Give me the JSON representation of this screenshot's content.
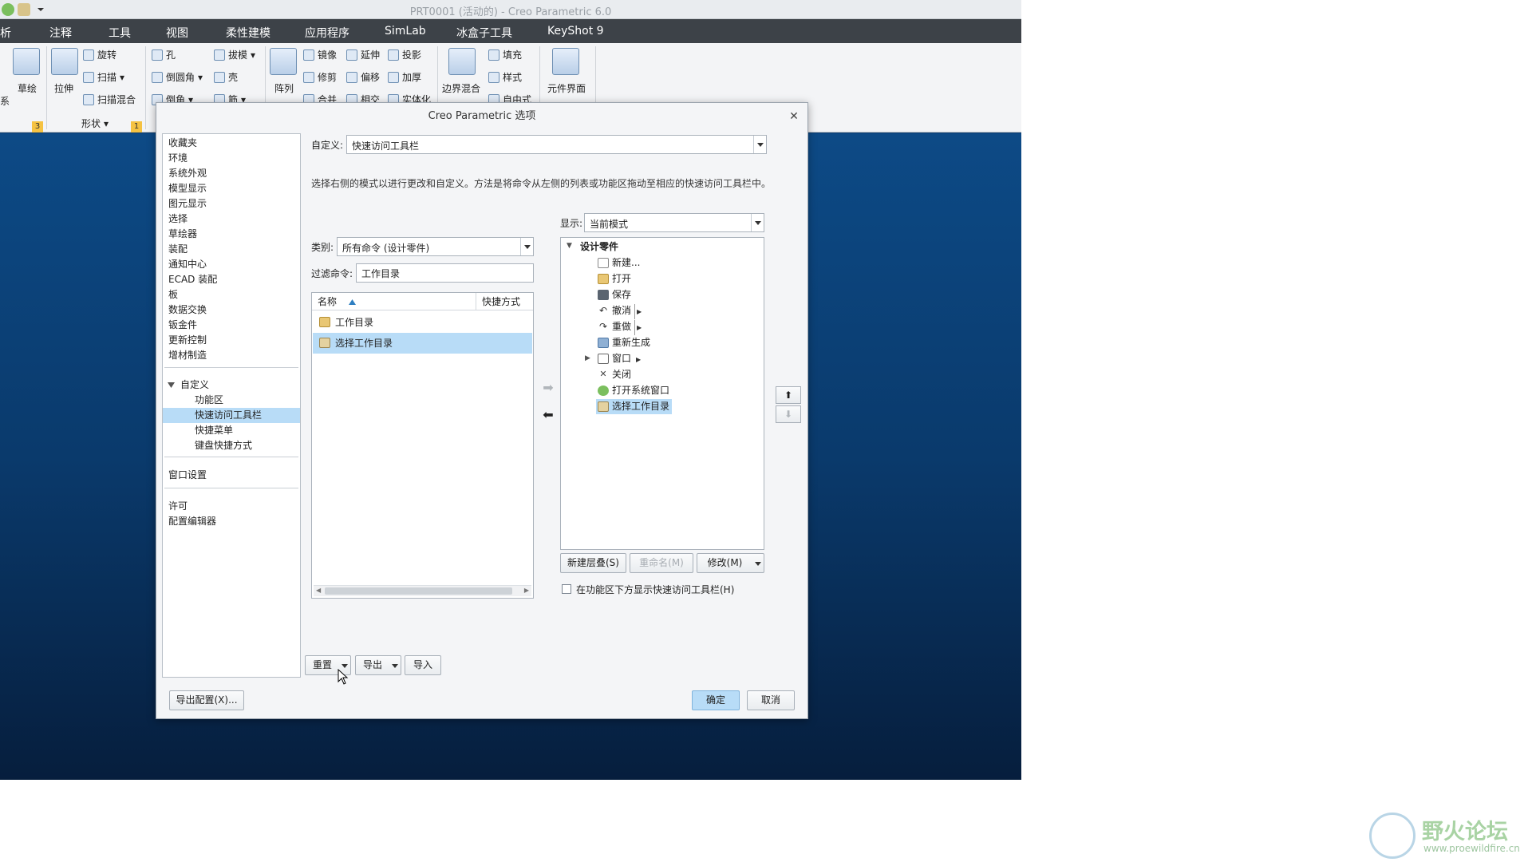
{
  "window": {
    "title": "PRT0001 (活动的) - Creo Parametric 6.0"
  },
  "menu": [
    "析",
    "注释",
    "工具",
    "视图",
    "柔性建模",
    "应用程序",
    "SimLab",
    "冰盒子工具",
    "KeyShot 9"
  ],
  "ribbon": {
    "sketch": "草绘",
    "extrude": "拉伸",
    "revolve": "旋转",
    "sweep": "扫描",
    "swept_blend": "扫描混合",
    "system": "系",
    "hole": "孔",
    "round": "倒圆角",
    "chamfer": "倒角",
    "draft": "拔模",
    "shell": "壳",
    "rib": "筋",
    "shape_group": "形状",
    "pattern": "阵列",
    "mirror": "镜像",
    "trim": "修剪",
    "merge": "合并",
    "extend": "延伸",
    "offset": "偏移",
    "intersect": "相交",
    "project": "投影",
    "thicken": "加厚",
    "solidify": "实体化",
    "boundary_blend": "边界混合",
    "fill": "填充",
    "style": "样式",
    "freestyle": "自由式",
    "component_interface": "元件界面",
    "badge_3": "3",
    "badge_1": "1"
  },
  "dialog": {
    "title": "Creo Parametric 选项",
    "nav_items": [
      "收藏夹",
      "环境",
      "系统外观",
      "模型显示",
      "图元显示",
      "选择",
      "草绘器",
      "装配",
      "通知中心",
      "ECAD 装配",
      "板",
      "数据交换",
      "钣金件",
      "更新控制",
      "增材制造"
    ],
    "nav_customize": "自定义",
    "nav_customize_sub": [
      "功能区",
      "快速访问工具栏",
      "快捷菜单",
      "键盘快捷方式"
    ],
    "nav_window": "窗口设置",
    "nav_license": "许可",
    "nav_config": "配置编辑器",
    "customize_label": "自定义:",
    "customize_value": "快速访问工具栏",
    "description": "选择右侧的模式以进行更改和自定义。方法是将命令从左侧的列表或功能区拖动至相应的快速访问工具栏中。",
    "category_label": "类别:",
    "category_value": "所有命令 (设计零件)",
    "filter_label": "过滤命令:",
    "filter_value": "工作目录",
    "col_name": "名称",
    "col_shortcut": "快捷方式",
    "commands": [
      "工作目录",
      "选择工作目录"
    ],
    "show_label": "显示:",
    "show_value": "当前模式",
    "tree_root": "设计零件",
    "tree_items": [
      "新建...",
      "打开",
      "保存",
      "撤消",
      "重做",
      "重新生成",
      "窗口",
      "关闭",
      "打开系统窗口",
      "选择工作目录"
    ],
    "new_cascade": "新建层叠(S)",
    "rename": "重命名(M)",
    "modify": "修改(M)",
    "show_below_ribbon": "在功能区下方显示快速访问工具栏(H)",
    "reset": "重置",
    "export": "导出",
    "import": "导入",
    "export_config": "导出配置(X)...",
    "ok": "确定",
    "cancel": "取消"
  },
  "watermark": {
    "text": "野火论坛",
    "url": "www.proewildfire.cn"
  }
}
